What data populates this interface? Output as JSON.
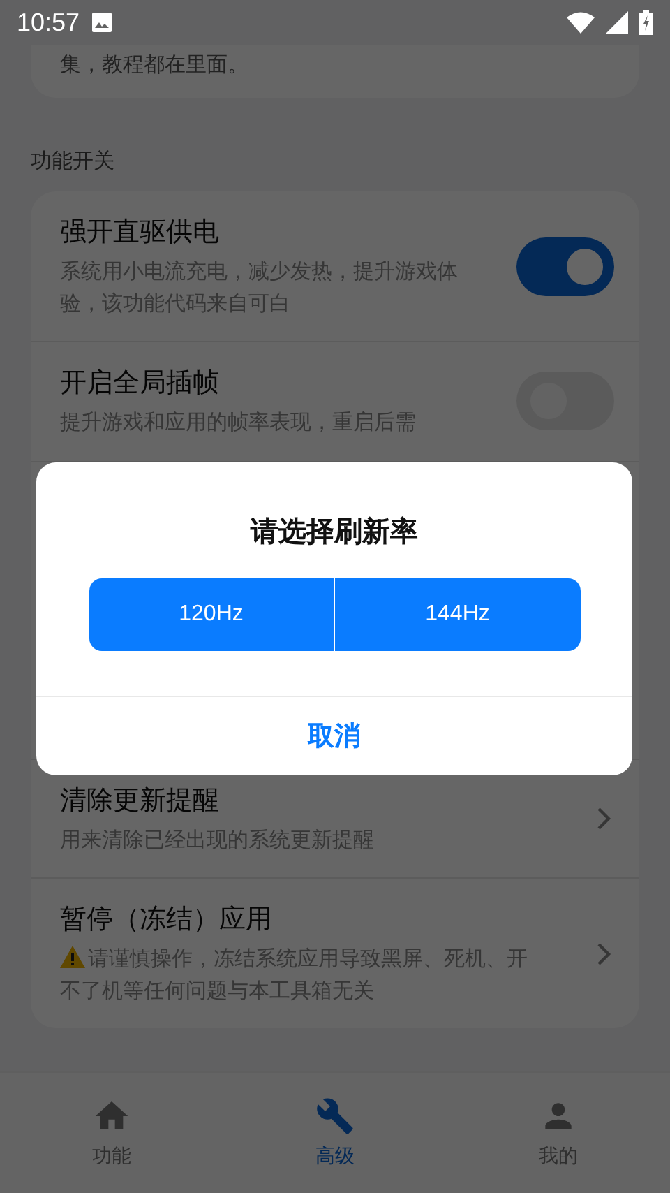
{
  "status_bar": {
    "time": "10:57"
  },
  "intro_card": {
    "text": "集，教程都在里面。"
  },
  "section_title": "功能开关",
  "switch_rows": [
    {
      "title": "强开直驱供电",
      "description": "系统用小电流充电，减少发热，提升游戏体验，该功能代码来自可白",
      "on": true
    },
    {
      "title": "开启全局插帧",
      "description": "提升游戏和应用的帧率表现，重启后需",
      "on": false
    }
  ],
  "action_rows": [
    {
      "title": "清除更新提醒",
      "description": "用来清除已经出现的系统更新提醒",
      "warning": false
    },
    {
      "title": "暂停（冻结）应用",
      "description": "请谨慎操作，冻结系统应用导致黑屏、死机、开不了机等任何问题与本工具箱无关",
      "warning": true
    }
  ],
  "dialog": {
    "title": "请选择刷新率",
    "options": [
      {
        "label": "120Hz"
      },
      {
        "label": "144Hz"
      }
    ],
    "cancel": "取消"
  },
  "bottom_nav": [
    {
      "label": "功能",
      "kind": "home",
      "selected": false
    },
    {
      "label": "高级",
      "kind": "tools",
      "selected": true
    },
    {
      "label": "我的",
      "kind": "person",
      "selected": false
    }
  ]
}
